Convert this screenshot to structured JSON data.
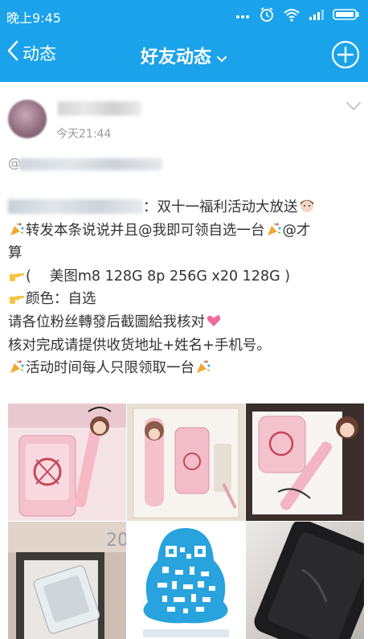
{
  "status_bar": {
    "time": "晚上9:45",
    "icons": [
      "dots-icon",
      "alarm-icon",
      "wifi-icon",
      "signal-icon",
      "battery-icon"
    ]
  },
  "nav": {
    "back_label": "动态",
    "title": "好友动态",
    "icons": [
      "back-chevron-icon",
      "chevron-down-icon",
      "plus-circle-icon"
    ]
  },
  "post": {
    "time": "今天21:44",
    "at_symbol": "@",
    "lines": [
      {
        "text": "：双十一福利活动大放送",
        "emoji_after": "girl-emoji"
      },
      {
        "emoji_before": "party-popper-emoji",
        "text": "转发本条说说并且@我即可领自选一台",
        "emoji_after": "party-popper-emoji",
        "tail": "@才"
      },
      {
        "text": "算"
      },
      {
        "emoji_before": "pointing-hand-emoji",
        "text": "(　 美图m8 128G  8p 256G x20 128G  )"
      },
      {
        "emoji_before": "pointing-hand-emoji",
        "text": "颜色：自选"
      },
      {
        "text": "请各位粉丝轉發后截圖給我核对",
        "emoji_after": "hearts-emoji"
      },
      {
        "text": "核对完成请提供收货地址+姓名+手机号。"
      },
      {
        "emoji_before": "party-popper-emoji",
        "text": "活动时间每人只限领取一台",
        "emoji_after": "party-popper-emoji"
      }
    ],
    "photos": [
      "pink-phone-box-photo",
      "pink-selfie-stick-photo",
      "pink-phone-with-stick-photo",
      "phone-in-box-photo",
      "qr-code-photo",
      "black-phone-photo"
    ]
  },
  "colors": {
    "header_blue": "#1aa3ea",
    "text": "#333333",
    "muted": "#999999",
    "pink": "#f2c4cf"
  }
}
